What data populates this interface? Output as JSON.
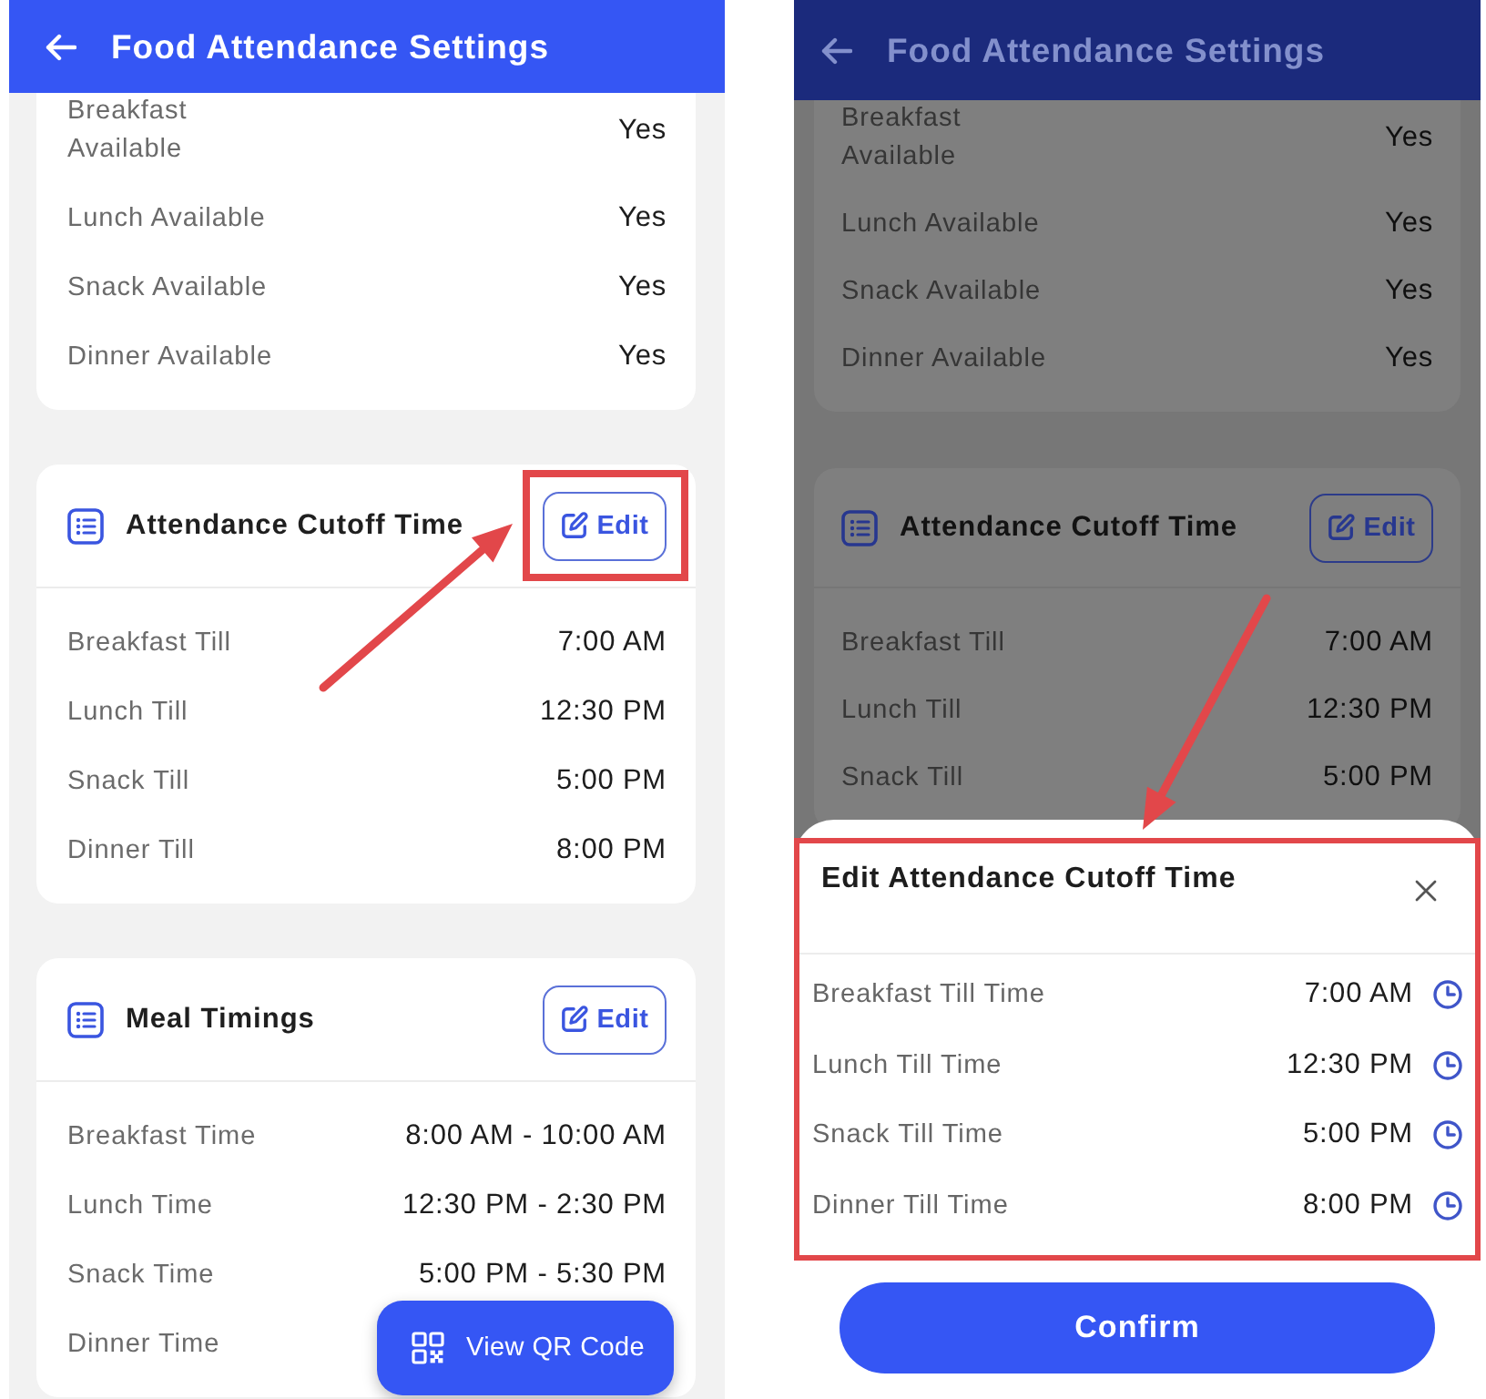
{
  "screens": [
    {
      "dimmed": false,
      "header": {
        "title": "Food Attendance Settings"
      },
      "cards": [
        {
          "rows": [
            {
              "label": "Breakfast Available",
              "value": "Yes"
            },
            {
              "label": "Lunch Available",
              "value": "Yes"
            },
            {
              "label": "Snack Available",
              "value": "Yes"
            },
            {
              "label": "Dinner Available",
              "value": "Yes"
            }
          ]
        },
        {
          "title": "Attendance Cutoff Time",
          "edit": {
            "label": "Edit",
            "highlighted": true
          },
          "rows": [
            {
              "label": "Breakfast Till",
              "value": "7:00 AM"
            },
            {
              "label": "Lunch Till",
              "value": "12:30 PM"
            },
            {
              "label": "Snack Till",
              "value": "5:00 PM"
            },
            {
              "label": "Dinner Till",
              "value": "8:00 PM"
            }
          ]
        },
        {
          "title": "Meal Timings",
          "edit": {
            "label": "Edit",
            "highlighted": false
          },
          "rows": [
            {
              "label": "Breakfast Time",
              "value": "8:00 AM - 10:00 AM"
            },
            {
              "label": "Lunch Time",
              "value": "12:30 PM - 2:30 PM"
            },
            {
              "label": "Snack Time",
              "value": "5:00 PM - 5:30 PM"
            },
            {
              "label": "Dinner Time"
            }
          ]
        }
      ],
      "fab": {
        "label": "View QR Code"
      }
    },
    {
      "dimmed": true,
      "header": {
        "title": "Food Attendance Settings"
      },
      "cards": [
        {
          "rows": [
            {
              "label": "Breakfast Available",
              "value": "Yes"
            },
            {
              "label": "Lunch Available",
              "value": "Yes"
            },
            {
              "label": "Snack Available",
              "value": "Yes"
            },
            {
              "label": "Dinner Available",
              "value": "Yes"
            }
          ]
        },
        {
          "title": "Attendance Cutoff Time",
          "edit": {
            "label": "Edit",
            "highlighted": false
          },
          "rows": [
            {
              "label": "Breakfast Till",
              "value": "7:00 AM"
            },
            {
              "label": "Lunch Till",
              "value": "12:30 PM"
            },
            {
              "label": "Snack Till",
              "value": "5:00 PM"
            }
          ]
        }
      ],
      "sheet": {
        "title": "Edit Attendance Cutoff Time",
        "highlighted": true,
        "rows": [
          {
            "label": "Breakfast Till Time",
            "value": "7:00 AM"
          },
          {
            "label": "Lunch Till Time",
            "value": "12:30 PM"
          },
          {
            "label": "Snack Till Time",
            "value": "5:00 PM"
          },
          {
            "label": "Dinner Till Time",
            "value": "8:00 PM"
          }
        ],
        "confirm": {
          "label": "Confirm"
        }
      }
    }
  ]
}
